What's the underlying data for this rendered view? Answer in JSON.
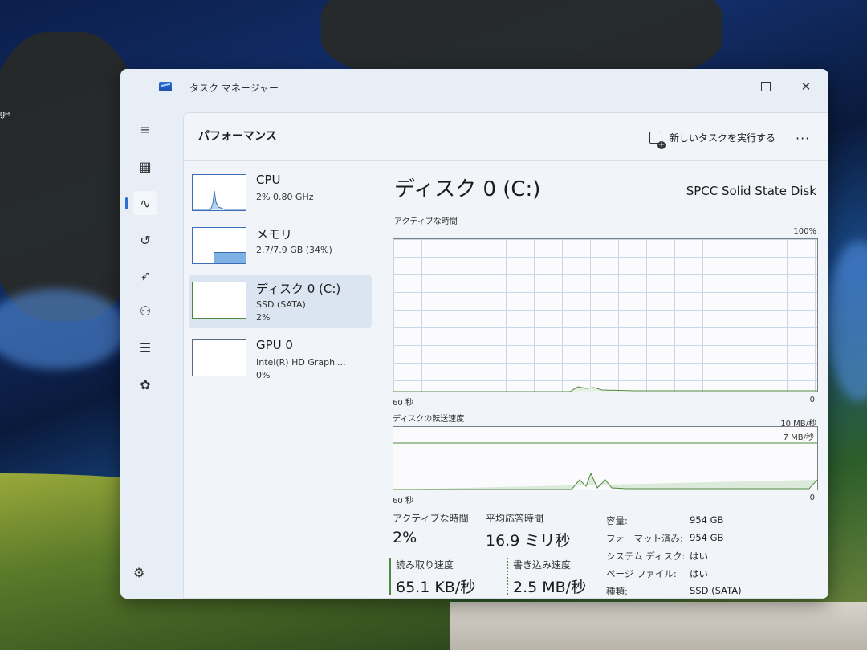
{
  "background": {
    "partial_text": "ge"
  },
  "window": {
    "title": "タスク マネージャー",
    "controls": {
      "minimize": "minimize",
      "maximize": "maximize",
      "close": "close"
    }
  },
  "nav": {
    "items": [
      {
        "icon": "hamburger-icon",
        "glyph": "≡"
      },
      {
        "icon": "processes-icon",
        "glyph": "▦"
      },
      {
        "icon": "performance-icon",
        "glyph": "∿",
        "active": true
      },
      {
        "icon": "app-history-icon",
        "glyph": "↺"
      },
      {
        "icon": "startup-icon",
        "glyph": "➶"
      },
      {
        "icon": "users-icon",
        "glyph": "⚇"
      },
      {
        "icon": "details-icon",
        "glyph": "☰"
      },
      {
        "icon": "services-icon",
        "glyph": "✿"
      }
    ],
    "settings_icon": "⚙"
  },
  "header": {
    "title": "パフォーマンス",
    "new_task": "新しいタスクを実行する",
    "more": "···"
  },
  "perf_list": [
    {
      "name": "CPU",
      "sub1": "2%  0.80 GHz",
      "sub2": ""
    },
    {
      "name": "メモリ",
      "sub1": "2.7/7.9 GB (34%)",
      "sub2": ""
    },
    {
      "name": "ディスク 0 (C:)",
      "sub1": "SSD (SATA)",
      "sub2": "2%"
    },
    {
      "name": "GPU 0",
      "sub1": "Intel(R) HD Graphi...",
      "sub2": "0%"
    }
  ],
  "detail": {
    "title": "ディスク 0 (C:)",
    "model": "SPCC Solid State Disk",
    "graph1": {
      "label": "アクティブな時間",
      "max": "100%",
      "xleft": "60 秒",
      "xright": "0"
    },
    "graph2": {
      "label": "ディスクの転送速度",
      "max": "10 MB/秒",
      "line": "7 MB/秒",
      "xleft": "60 秒",
      "xright": "0"
    }
  },
  "stats": {
    "active_time_label": "アクティブな時間",
    "active_time_value": "2%",
    "avg_response_label": "平均応答時間",
    "avg_response_value": "16.9 ミリ秒",
    "read_label": "読み取り速度",
    "read_value": "65.1 KB/秒",
    "write_label": "書き込み速度",
    "write_value": "2.5 MB/秒"
  },
  "properties": [
    {
      "label": "容量:",
      "value": "954 GB"
    },
    {
      "label": "フォーマット済み:",
      "value": "954 GB"
    },
    {
      "label": "システム ディスク:",
      "value": "はい"
    },
    {
      "label": "ページ ファイル:",
      "value": "はい"
    },
    {
      "label": "種類:",
      "value": "SSD (SATA)"
    }
  ],
  "colors": {
    "accent": "#2d6fd1",
    "disk_green": "#4f8a40"
  }
}
